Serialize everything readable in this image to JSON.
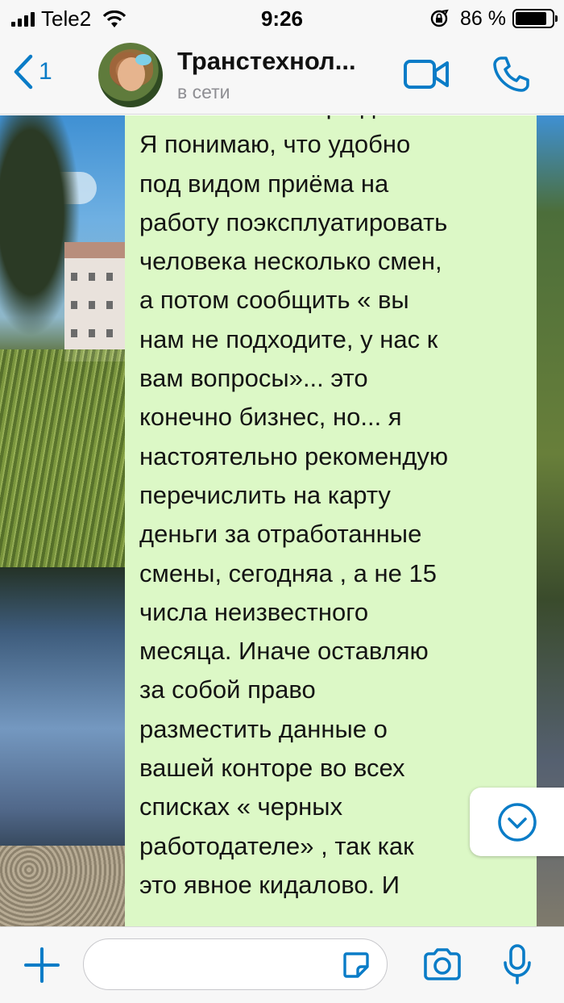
{
  "status_bar": {
    "carrier": "Tele2",
    "time": "9:26",
    "battery_percent": "86 %",
    "battery_level": 0.86,
    "icons": [
      "signal-icon",
      "wifi-icon",
      "rotation-lock-icon",
      "battery-icon"
    ]
  },
  "header": {
    "back_count": "1",
    "contact_name": "Транстехнол...",
    "contact_status": "в сети",
    "accent_color": "#0a7cc7",
    "icons": [
      "back-chevron-icon",
      "video-call-icon",
      "phone-icon"
    ]
  },
  "conversation": {
    "bubble_color": "#dcf8c6",
    "message_text": "...в вашей конторе две смены.\nЯ понимаю, что удобно\nпод видом приёма на\nработу поэксплуатировать\nчеловека несколько смен,\nа потом сообщить « вы\nнам не подходите, у нас к\nвам вопросы»... это\nконечно бизнес, но... я\nнастоятельно рекомендую\nперечислить на карту\nденьги за отработанные\nсмены, сегодняа , а не 15\nчисла неизвестного\nмесяца. Иначе оставляю\nза собой право\nразместить данные о\nвашей конторе во всех\nсписках « черных\nработодателе» , так как\nэто явное кидалово. И",
    "scroll_button_icon": "chevron-down-circle-icon"
  },
  "composer": {
    "input_value": "",
    "icons": [
      "plus-icon",
      "sticker-icon",
      "camera-icon",
      "microphone-icon"
    ]
  }
}
